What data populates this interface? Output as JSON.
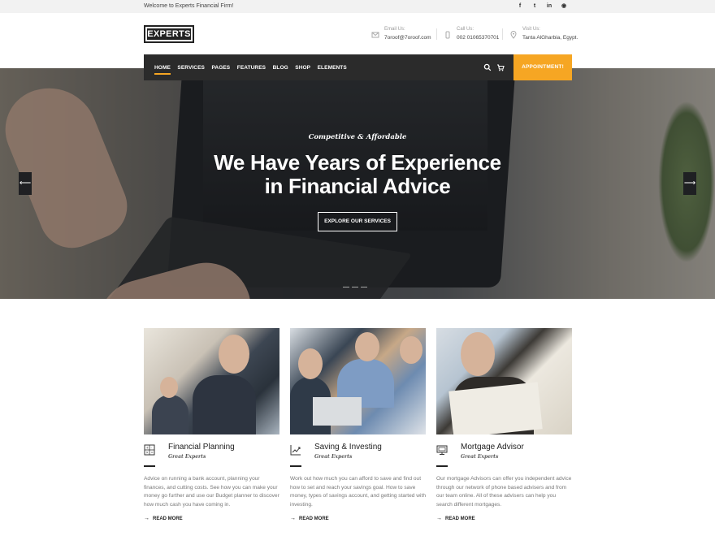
{
  "topbar": {
    "welcome": "Welcome to Experts Financial Firm!",
    "socials": [
      {
        "icon": "facebook-icon",
        "glyph": "f"
      },
      {
        "icon": "twitter-icon",
        "glyph": "t"
      },
      {
        "icon": "linkedin-icon",
        "glyph": "in"
      },
      {
        "icon": "rss-icon",
        "glyph": "◉"
      }
    ]
  },
  "header": {
    "logo": "EXPERTS",
    "contacts": [
      {
        "label": "Email Us:",
        "value": "7oroof@7oroof.com",
        "icon": "envelope-icon"
      },
      {
        "label": "Call Us:",
        "value": "002 01065370701",
        "icon": "phone-icon"
      },
      {
        "label": "Visit Us:",
        "value": "Tanta AlGharbia, Egypt.",
        "icon": "location-pin-icon"
      }
    ]
  },
  "nav": {
    "links": [
      "HOME",
      "SERVICES",
      "PAGES",
      "FEATURES",
      "BLOG",
      "SHOP",
      "ELEMENTS"
    ],
    "active": "HOME",
    "appointment": "APPOINTMENT!"
  },
  "hero": {
    "subtitle": "Competitive & Affordable",
    "title_line1": "We Have Years of Experience",
    "title_line2": "in Financial Advice",
    "button": "EXPLORE OUR SERVICES",
    "prev": "⟵",
    "next": "⟶"
  },
  "services": [
    {
      "title": "Financial Planning",
      "tag": "Great Experts",
      "icon": "calculator-icon",
      "text": "Advice on running a bank account, planning your finances, and cutting costs. See how you can make your money go further and use our Budget planner to discover how much cash you have coming in.",
      "more": "READ MORE"
    },
    {
      "title": "Saving & Investing",
      "tag": "Great Experts",
      "icon": "chart-icon",
      "text": "Work out how much you can afford to save and find out how to set and reach your savings goal. How to save money, types of savings account, and getting started with investing.",
      "more": "READ MORE"
    },
    {
      "title": "Mortgage Advisor",
      "tag": "Great Experts",
      "icon": "monitor-icon",
      "text": "Our mortgage Advisors can offer you independent advice through our network of phone based advisers and from our team online. All of these advisers can help you search different mortgages.",
      "more": "READ MORE"
    }
  ],
  "colors": {
    "accent": "#f6a623",
    "nav_bg": "#2b2b2b",
    "topbar_bg": "#f2f2f2"
  }
}
